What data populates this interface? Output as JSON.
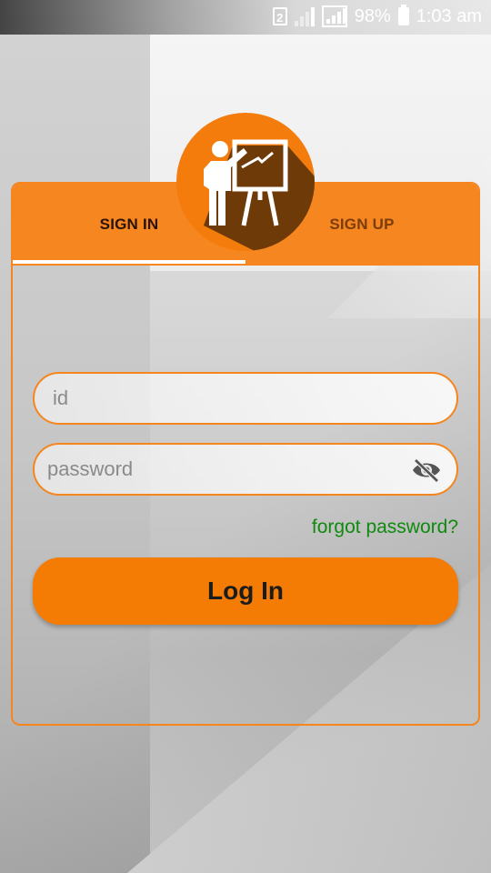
{
  "status_bar": {
    "sim_number": "2",
    "battery_percent": "98%",
    "battery_level": 0.98,
    "time": "1:03 am",
    "icons": [
      "sim-icon",
      "signal-icon",
      "signal-icon",
      "battery-icon"
    ]
  },
  "tabs": {
    "sign_in": "SIGN IN",
    "sign_up": "SIGN UP",
    "active": "sign_in"
  },
  "logo": {
    "icon": "teacher-presentation-icon"
  },
  "form": {
    "id_placeholder": "id",
    "password_placeholder": "password",
    "toggle_icon": "eye-off-icon",
    "forgot_label": "forgot password?",
    "login_label": "Log In"
  },
  "colors": {
    "accent": "#f6861f",
    "button": "#f47c04",
    "link": "#0f8a0f",
    "logo_shadow": "#6d3a08"
  }
}
